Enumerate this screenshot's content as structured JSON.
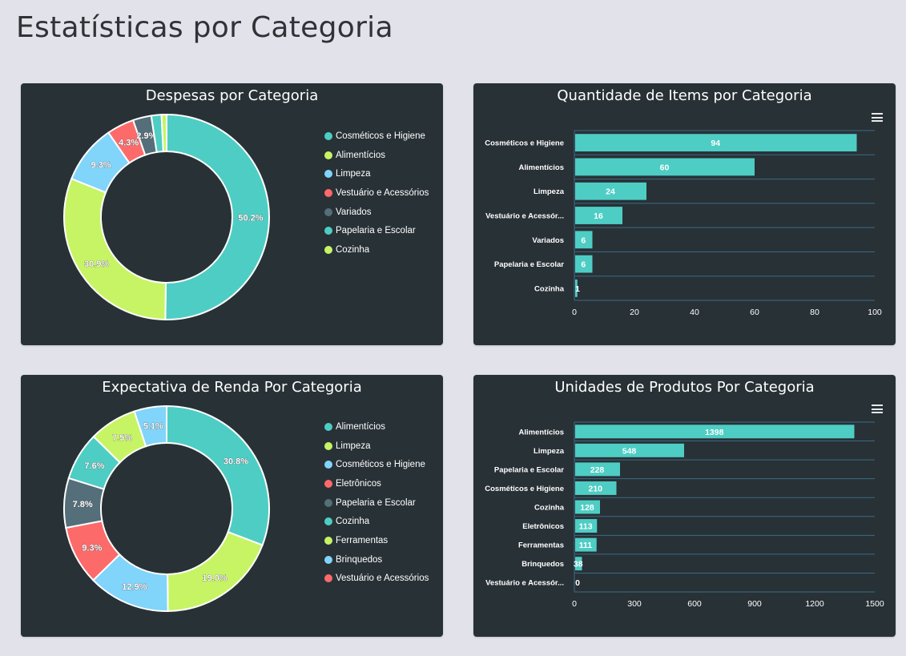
{
  "page": {
    "title": "Estatísticas por Categoria"
  },
  "colors": [
    "#4ecdc4",
    "#c7f464",
    "#81d4fa",
    "#fd6a6a",
    "#546e7a"
  ],
  "chart_data": [
    {
      "type": "pie",
      "donut": true,
      "title": "Despesas por Categoria",
      "labels": [
        "Cosméticos e Higiene",
        "Alimentícios",
        "Limpeza",
        "Vestuário e Acessórios",
        "Variados",
        "Papelaria e Escolar",
        "Cozinha"
      ],
      "values": [
        50.2,
        30.9,
        9.3,
        4.3,
        2.9,
        1.6,
        0.8
      ],
      "data_labels": [
        "50.2%",
        "30.9%",
        "9.3%",
        "4.3%",
        "2.9%",
        "",
        ""
      ],
      "legend": "right"
    },
    {
      "type": "bar",
      "orientation": "horizontal",
      "title": "Quantidade de Items por Categoria",
      "categories": [
        "Cosméticos e Higiene",
        "Alimentícios",
        "Limpeza",
        "Vestuário e Acessór...",
        "Variados",
        "Papelaria e Escolar",
        "Cozinha"
      ],
      "values": [
        94,
        60,
        24,
        16,
        6,
        6,
        1
      ],
      "xlim": [
        0,
        100
      ],
      "xticks": [
        "0",
        "20",
        "40",
        "60",
        "80",
        "100"
      ]
    },
    {
      "type": "pie",
      "donut": true,
      "title": "Expectativa de Renda Por Categoria",
      "labels": [
        "Alimentícios",
        "Limpeza",
        "Cosméticos e Higiene",
        "Eletrônicos",
        "Papelaria e Escolar",
        "Cozinha",
        "Ferramentas",
        "Brinquedos",
        "Vestuário e Acessórios"
      ],
      "values": [
        30.8,
        19.0,
        12.9,
        9.3,
        7.8,
        7.6,
        7.5,
        5.1,
        0.0
      ],
      "data_labels": [
        "30.8%",
        "19.0%",
        "12.9%",
        "9.3%",
        "7.8%",
        "7.6%",
        "7.5%",
        "5.1%",
        ""
      ],
      "legend": "right"
    },
    {
      "type": "bar",
      "orientation": "horizontal",
      "title": "Unidades de Produtos Por Categoria",
      "categories": [
        "Alimentícios",
        "Limpeza",
        "Papelaria e Escolar",
        "Cosméticos e Higiene",
        "Cozinha",
        "Eletrônicos",
        "Ferramentas",
        "Brinquedos",
        "Vestuário e Acessór..."
      ],
      "values": [
        1398,
        548,
        228,
        210,
        128,
        113,
        111,
        38,
        0
      ],
      "xlim": [
        0,
        1500
      ],
      "xticks": [
        "0",
        "300",
        "600",
        "900",
        "1200",
        "1500"
      ]
    }
  ]
}
